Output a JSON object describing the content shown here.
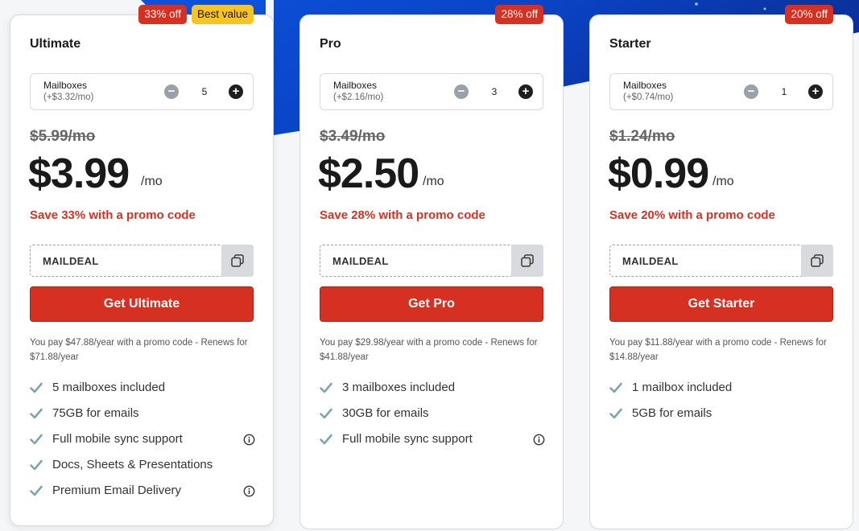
{
  "plans": [
    {
      "badges": [
        "33% off",
        "Best value"
      ],
      "name": "Ultimate",
      "mailboxes_label": "Mailboxes",
      "mailbox_price": "(+$3.32/mo)",
      "quantity": "5",
      "old_price": "$5.99/mo",
      "price": "$3.99",
      "per": "/mo",
      "save": "Save 33% with a promo code",
      "promo_code": "MAILDEAL",
      "cta": "Get Ultimate",
      "note": "You pay $47.88/year with a promo code - Renews for $71.88/year",
      "features": [
        {
          "text": "5 mailboxes included",
          "info": false
        },
        {
          "text": "75GB for emails",
          "info": false
        },
        {
          "text": "Full mobile sync support",
          "info": true
        },
        {
          "text": "Docs, Sheets & Presentations",
          "info": false
        },
        {
          "text": "Premium Email Delivery",
          "info": true
        }
      ]
    },
    {
      "badges": [
        "28% off"
      ],
      "name": "Pro",
      "mailboxes_label": "Mailboxes",
      "mailbox_price": "(+$2.16/mo)",
      "quantity": "3",
      "old_price": "$3.49/mo",
      "price": "$2.50",
      "per": "/mo",
      "save": "Save 28% with a promo code",
      "promo_code": "MAILDEAL",
      "cta": "Get Pro",
      "note": "You pay $29.98/year with a promo code - Renews for $41.88/year",
      "features": [
        {
          "text": "3 mailboxes included",
          "info": false
        },
        {
          "text": "30GB for emails",
          "info": false
        },
        {
          "text": "Full mobile sync support",
          "info": true
        }
      ]
    },
    {
      "badges": [
        "20% off"
      ],
      "name": "Starter",
      "mailboxes_label": "Mailboxes",
      "mailbox_price": "(+$0.74/mo)",
      "quantity": "1",
      "old_price": "$1.24/mo",
      "price": "$0.99",
      "per": "/mo",
      "save": "Save 20% with a promo code",
      "promo_code": "MAILDEAL",
      "cta": "Get Starter",
      "note": "You pay $11.88/year with a promo code - Renews for $14.88/year",
      "features": [
        {
          "text": "1 mailbox included",
          "info": false
        },
        {
          "text": "5GB for emails",
          "info": false
        }
      ]
    }
  ],
  "icons": {
    "minus": "minus-icon",
    "plus": "plus-icon",
    "copy": "copy-icon",
    "check": "check-icon",
    "info": "info-icon"
  },
  "colors": {
    "accent_red": "#d63022",
    "badge_yellow": "#f7c325",
    "check_teal": "#7aa6ad",
    "background_blue": "#0a4fd6"
  }
}
